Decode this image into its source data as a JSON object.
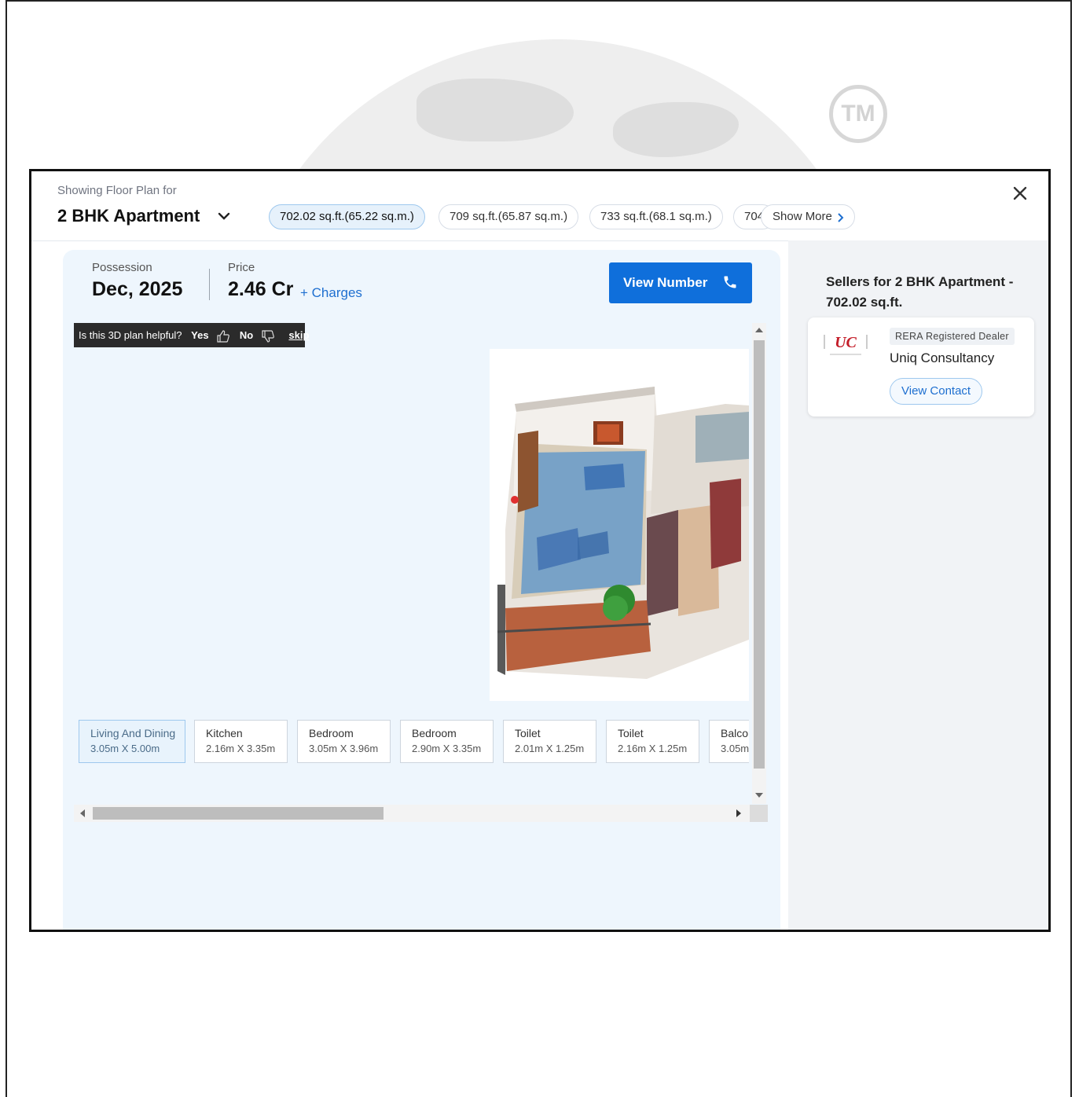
{
  "header": {
    "showing_label": "Showing Floor Plan for",
    "title": "2 BHK Apartment",
    "chips": [
      "702.02 sq.ft.(65.22 sq.m.)",
      "709 sq.ft.(65.87 sq.m.)",
      "733 sq.ft.(68.1 sq.m.)",
      "704"
    ],
    "active_chip_index": 0,
    "show_more": "Show More"
  },
  "details": {
    "possession_label": "Possession",
    "possession_value": "Dec, 2025",
    "price_label": "Price",
    "price_value": "2.46 Cr",
    "charges_link": "+ Charges",
    "view_number_label": "View Number"
  },
  "feedback": {
    "question": "Is this 3D plan helpful?",
    "yes": "Yes",
    "no": "No",
    "skip": "skip"
  },
  "rooms": [
    {
      "name": "Living And Dining",
      "dim": "3.05m X 5.00m"
    },
    {
      "name": "Kitchen",
      "dim": "2.16m X 3.35m"
    },
    {
      "name": "Bedroom",
      "dim": "3.05m X 3.96m"
    },
    {
      "name": "Bedroom",
      "dim": "2.90m X 3.35m"
    },
    {
      "name": "Toilet",
      "dim": "2.01m X 1.25m"
    },
    {
      "name": "Toilet",
      "dim": "2.16m X 1.25m"
    },
    {
      "name": "Balcor",
      "dim": "3.05m"
    }
  ],
  "sellers": {
    "title": "Sellers for 2 BHK Apartment - 702.02 sq.ft.",
    "badge": "RERA Registered Dealer",
    "name": "Uniq Consultancy",
    "view_contact": "View Contact",
    "logo_text": "UC"
  },
  "background": {
    "tm_text": "TM"
  },
  "colors": {
    "accent": "#0f6fdb",
    "link": "#1e6fd0",
    "highlight": "#1f7fd6"
  }
}
